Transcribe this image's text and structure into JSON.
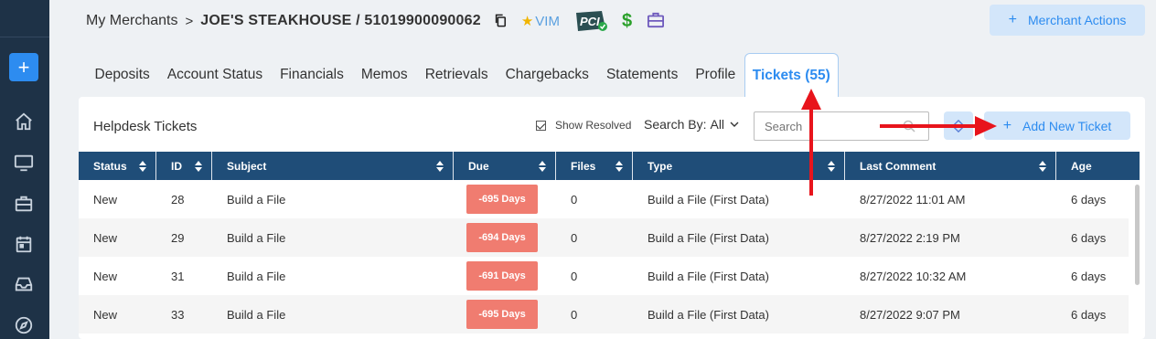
{
  "breadcrumb": {
    "parent": "My Merchants",
    "separator": ">",
    "merchant": "JOE'S STEAKHOUSE / 51019900090062",
    "vim_label": "VIM"
  },
  "header": {
    "merchant_actions_label": "Merchant Actions"
  },
  "tabs": [
    {
      "label": "Deposits"
    },
    {
      "label": "Account Status"
    },
    {
      "label": "Financials"
    },
    {
      "label": "Memos"
    },
    {
      "label": "Retrievals"
    },
    {
      "label": "Chargebacks"
    },
    {
      "label": "Statements"
    },
    {
      "label": "Profile"
    },
    {
      "label": "Tickets (55)",
      "active": true
    }
  ],
  "panel": {
    "title": "Helpdesk Tickets",
    "show_resolved_label": "Show Resolved",
    "show_resolved_checked": true,
    "search_by_label": "Search By:",
    "search_by_value": "All",
    "search_placeholder": "Search",
    "add_ticket_label": "Add New Ticket"
  },
  "table": {
    "columns": [
      "Status",
      "ID",
      "Subject",
      "Due",
      "Files",
      "Type",
      "Last Comment",
      "Age"
    ],
    "rows": [
      {
        "status": "New",
        "id": "28",
        "subject": "Build a File",
        "due": "-695 Days",
        "files": "0",
        "type": "Build a File (First Data)",
        "last_comment": "8/27/2022 11:01 AM",
        "age": "6 days"
      },
      {
        "status": "New",
        "id": "29",
        "subject": "Build a File",
        "due": "-694 Days",
        "files": "0",
        "type": "Build a File (First Data)",
        "last_comment": "8/27/2022 2:19 PM",
        "age": "6 days"
      },
      {
        "status": "New",
        "id": "31",
        "subject": "Build a File",
        "due": "-691 Days",
        "files": "0",
        "type": "Build a File (First Data)",
        "last_comment": "8/27/2022 10:32 AM",
        "age": "6 days"
      },
      {
        "status": "New",
        "id": "33",
        "subject": "Build a File",
        "due": "-695 Days",
        "files": "0",
        "type": "Build a File (First Data)",
        "last_comment": "8/27/2022 9:07 PM",
        "age": "6 days"
      }
    ]
  },
  "sidebar": {
    "add_label": "+",
    "icons": [
      "home-icon",
      "monitor-icon",
      "briefcase-icon",
      "calendar-icon",
      "inbox-icon",
      "compass-icon"
    ]
  },
  "colors": {
    "accent": "#2d8cf0",
    "header_row": "#1f4d78",
    "due_badge": "#f07c70",
    "sidebar": "#1e3247",
    "annotation_arrow": "#e8141c"
  }
}
